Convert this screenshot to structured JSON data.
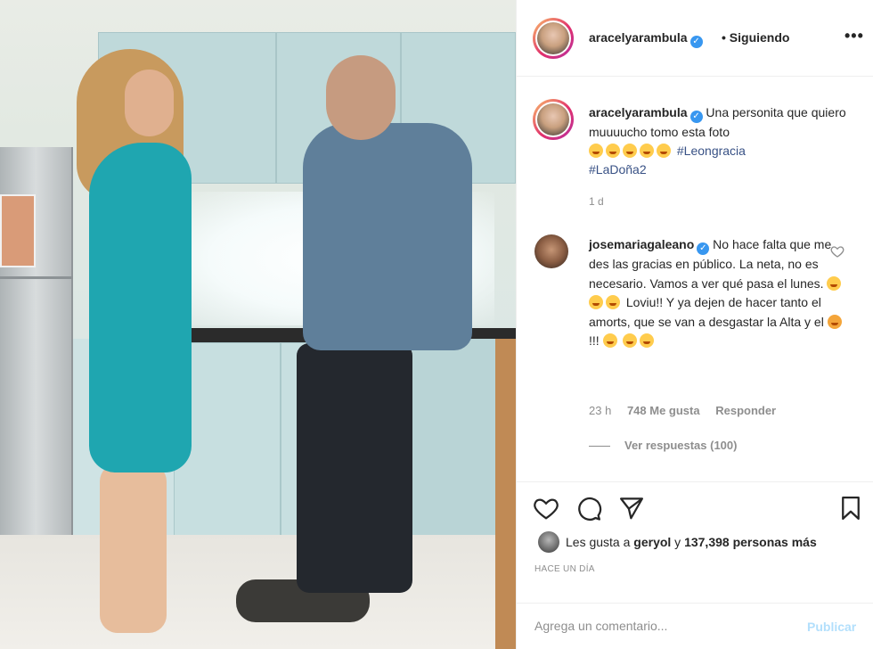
{
  "header": {
    "username": "aracelyarambula",
    "follow_state": "• Siguiendo",
    "more_icon": "more-horizontal-icon"
  },
  "caption": {
    "username": "aracelyarambula",
    "text": "Una personita que quiero muuuucho tomo esta foto",
    "emojis": [
      "heart-eyes",
      "kiss",
      "kiss",
      "kiss",
      "kiss"
    ],
    "hashtags": [
      "#Leongracia",
      "#LaDoña2"
    ],
    "time": "1 d"
  },
  "comment": {
    "username": "josemariagaleano",
    "text_1": "No hace falta que me des las gracias en público. La neta, no es necesario. Vamos a ver qué pasa el lunes.",
    "text_2": "Loviu!! Y ya dejen de hacer tanto el amorts, que se van a desgastar la Alta y el",
    "text_3": "!!!",
    "time": "23 h",
    "likes": "748 Me gusta",
    "reply_label": "Responder",
    "view_replies": "Ver respuestas (100)"
  },
  "actions": {
    "like_icon": "heart-icon",
    "comment_icon": "comment-icon",
    "share_icon": "send-icon",
    "save_icon": "bookmark-icon"
  },
  "likes": {
    "prefix": "Les gusta a ",
    "user": "geryol",
    "middle": " y ",
    "count": "137,398 personas más"
  },
  "posted_ago": "HACE UN DÍA",
  "composer": {
    "placeholder": "Agrega un comentario...",
    "post_label": "Publicar"
  },
  "colors": {
    "link": "#385185",
    "muted": "#8e8e8e",
    "verified": "#3897f0",
    "post_disabled": "#b2dffc"
  }
}
